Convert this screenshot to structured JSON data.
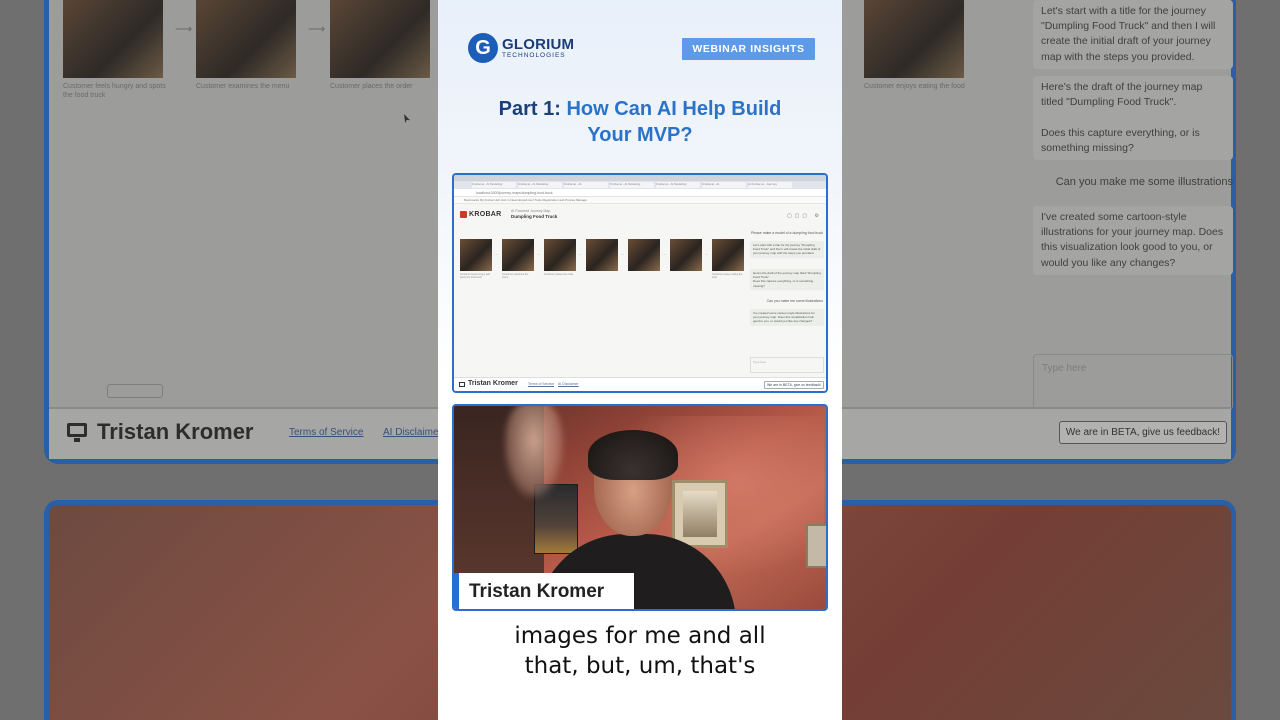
{
  "card": {
    "logo_letter": "G",
    "logo_main": "GLORIUM",
    "logo_sub": "TECHNOLOGIES",
    "badge": "WEBINAR INSIGHTS",
    "headline_prefix": "Part 1: ",
    "headline_highlight_line1": "How Can AI Help Build",
    "headline_highlight_line2": "Your MVP?"
  },
  "screenshot": {
    "app_name": "KROBAR",
    "project_label": "AI Powered Journey Map",
    "project_title": "Dumpling Food Truck",
    "url": "localhost:3000/journey-maps/dumpling-food-truck",
    "bookmarks": "Bookmarks   My Krobar Hub   Just in News   Experiment Tools   Registration and   Proxies Manage",
    "tabs": [
      "Krobar.ai - AI Modeling",
      "Krobar.ai - AI Modeling",
      "Krobar.ai - AI",
      "Krobar.ai - AI Modeling",
      "Krobar.ai - AI Modeling",
      "Krobar.ai - AI",
      "AI Krobar.ai - Journey"
    ],
    "captions": [
      "Customer feels hungry and spots the food truck",
      "Customer examines the menu",
      "Customer places the order",
      "",
      "",
      "",
      "Customer enjoys eating the food"
    ],
    "chat": {
      "user_top": "Please make a model of a dumpling food truck",
      "bot1": "Let's start with a title for the journey \"Dumpling Food Truck\" and then I will create the initial draft of your journey map with the steps you provided.",
      "bot2": "Here's the draft of the journey map titled \"Dumpling Food Truck\".",
      "bot2b": "Does this capture everything, or is something missing?",
      "user2": "Can you make me some illustrations",
      "bot3": "I've created some cartoon-style illustrations for your journey map. Does this visualization look good to you, or would you like any changes?",
      "type_placeholder": "Type here"
    },
    "footer_name": "Tristan Kromer",
    "footer_terms": "Terms of Service",
    "footer_ai": "AI Disclaimer",
    "footer_beta": "We are in BETA, give us feedback!"
  },
  "video": {
    "speaker_name": "Tristan Kromer"
  },
  "subtitles": {
    "line1": "images for me and all",
    "line2": "that, but, um, that's"
  },
  "background": {
    "name": "Tristan Kromer",
    "terms": "Terms of Service",
    "ai": "AI Disclaimer",
    "beta": "We are in BETA, give us feedback!",
    "captions": [
      "Customer feels hungry and spots the food truck",
      "Customer examines the menu",
      "Customer places the order",
      "Customer enjoys eating the food"
    ],
    "chat_bot1": "Let's start with a title for the journey \"Dumpling Food Truck\" and then I will create the initial draft of your journey map with the steps you provided.",
    "chat_bot2": "Here's the draft of the journey map titled \"Dumpling Food Truck\".",
    "chat_bot2b": "Does this capture everything, or is something missing?",
    "chat_user2": "Can you make me some illustrations",
    "chat_bot3": "I've created some cartoon-style illustrations for your journey map. Does this visualization look good to you, or would you like any changes?",
    "type_placeholder": "Type here"
  }
}
